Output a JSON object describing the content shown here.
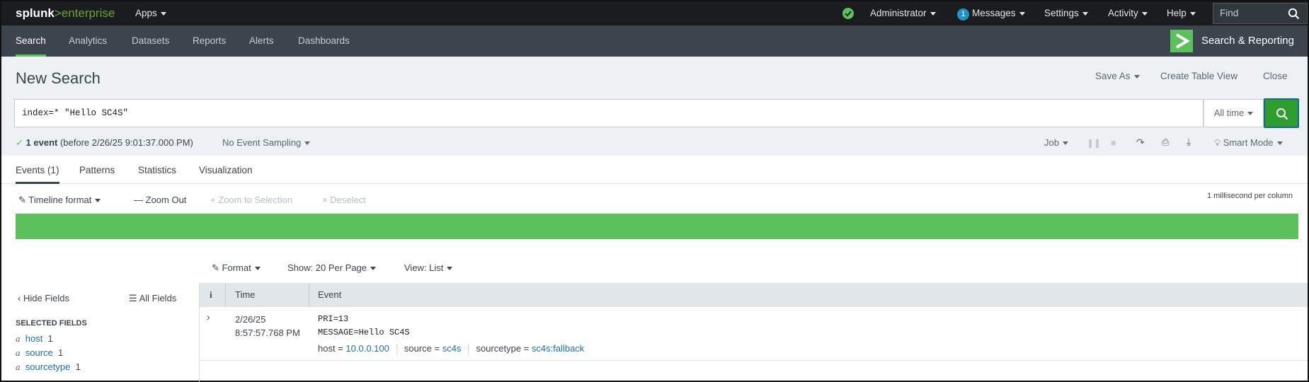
{
  "topbar": {
    "logo_splunk": "splunk",
    "logo_sep": ">",
    "logo_enterprise": "enterprise",
    "apps": "Apps",
    "user": "Administrator",
    "messages_count": "1",
    "messages": "Messages",
    "settings": "Settings",
    "activity": "Activity",
    "help": "Help",
    "find_placeholder": "Find"
  },
  "appbar": {
    "tabs": [
      "Search",
      "Analytics",
      "Datasets",
      "Reports",
      "Alerts",
      "Dashboards"
    ],
    "app_name": "Search & Reporting"
  },
  "search": {
    "title": "New Search",
    "save_as": "Save As",
    "create_table_view": "Create Table View",
    "close": "Close",
    "query": "index=* \"Hello SC4S\"",
    "time_range": "All time",
    "status_count": "1 event",
    "status_detail": "(before 2/26/25 9:01:37.000 PM)",
    "sampling": "No Event Sampling",
    "job": "Job",
    "mode": "Smart Mode"
  },
  "result_tabs": [
    "Events (1)",
    "Patterns",
    "Statistics",
    "Visualization"
  ],
  "timeline": {
    "format": "Timeline format",
    "zoom_out": "Zoom Out",
    "zoom_selection": "+ Zoom to Selection",
    "deselect": "× Deselect",
    "scale": "1 millisecond per column"
  },
  "events_toolbar": {
    "format": "Format",
    "per_page": "Show: 20 Per Page",
    "view": "View: List"
  },
  "sidebar": {
    "hide_fields": "Hide Fields",
    "all_fields": "All Fields",
    "selected_header": "SELECTED FIELDS",
    "fields": [
      {
        "type": "a",
        "name": "host",
        "count": "1"
      },
      {
        "type": "a",
        "name": "source",
        "count": "1"
      },
      {
        "type": "a",
        "name": "sourcetype",
        "count": "1"
      }
    ]
  },
  "table": {
    "col_info": "i",
    "col_time": "Time",
    "col_event": "Event",
    "rows": [
      {
        "date": "2/26/25",
        "time": "8:57:57.768 PM",
        "line1": "PRI=13",
        "line2": "MESSAGE=Hello SC4S",
        "host_label": "host =",
        "host_value": "10.0.0.100",
        "source_label": "source =",
        "source_value": "sc4s",
        "sourcetype_label": "sourcetype =",
        "sourcetype_value": "sc4s:fallback"
      }
    ]
  },
  "colors": {
    "topbar_bg": "#1a1c20",
    "appbar_bg": "#3c444d",
    "accent_green": "#5cc05c",
    "link_blue": "#1e6ea7",
    "panel_bg": "#eef1f4"
  }
}
